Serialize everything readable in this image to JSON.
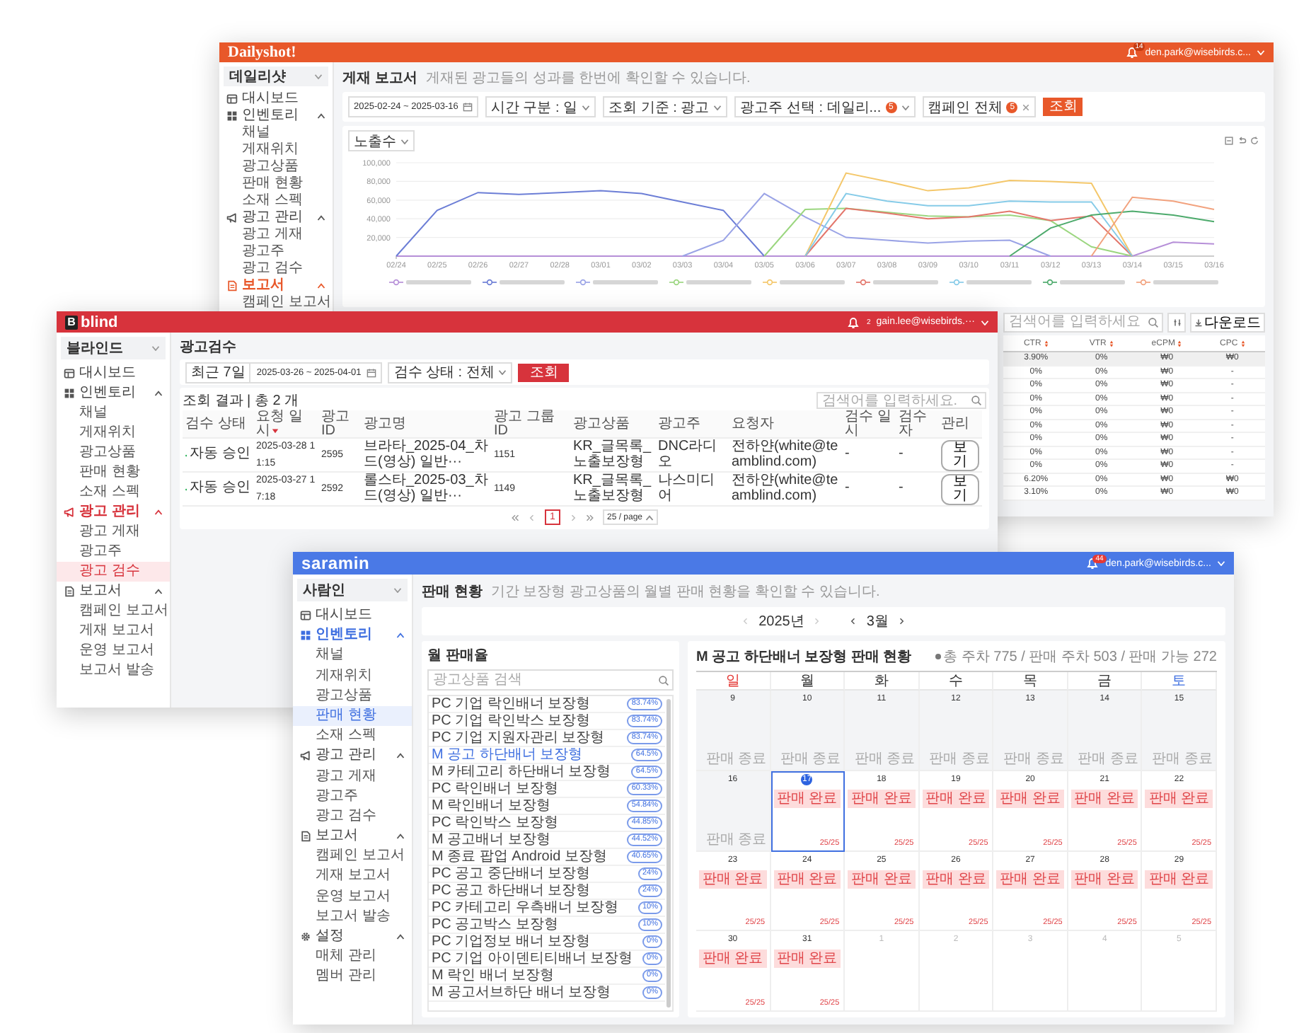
{
  "dailyshot": {
    "header": {
      "logo": "Dailyshot!",
      "notification_count": "14",
      "user": "den.park@wisebirds.c..."
    },
    "sidebar": {
      "workspace": "데일리샷",
      "items": [
        {
          "label": "대시보드",
          "kind": "dashboard",
          "active": false
        },
        {
          "label": "인벤토리",
          "kind": "inventory",
          "active": false,
          "expanded": true,
          "children": [
            {
              "label": "채널",
              "selected": false
            },
            {
              "label": "게재위치",
              "selected": false
            },
            {
              "label": "광고상품",
              "selected": false
            },
            {
              "label": "판매 현황",
              "selected": false
            },
            {
              "label": "소재 스펙",
              "selected": false
            }
          ]
        },
        {
          "label": "광고 관리",
          "kind": "ads",
          "active": false,
          "expanded": true,
          "children": [
            {
              "label": "광고 게재",
              "selected": false
            },
            {
              "label": "광고주",
              "selected": false
            },
            {
              "label": "광고 검수",
              "selected": false
            }
          ]
        },
        {
          "label": "보고서",
          "kind": "report",
          "active": true,
          "expanded": true,
          "children": [
            {
              "label": "캠페인 보고서",
              "selected": false
            }
          ]
        }
      ]
    },
    "page": {
      "title": "게재 보고서",
      "subtitle": "게재된 광고들의 성과를 한번에 확인할 수 있습니다."
    },
    "filters": [
      {
        "kind": "date",
        "value": "2025-02-24 ~ 2025-03-16"
      },
      {
        "kind": "select",
        "value": "시간 구분 : 일"
      },
      {
        "kind": "select",
        "value": "조회 기준 : 광고"
      },
      {
        "kind": "select",
        "value": "광고주 선택 : 데일리...",
        "count": "5"
      },
      {
        "kind": "tag",
        "value": "캠페인 전체",
        "count": "5"
      }
    ],
    "search_button": "조회",
    "metric_select": "노출수",
    "chart_data": {
      "type": "line",
      "categories": [
        "02/24",
        "02/25",
        "02/26",
        "02/27",
        "02/28",
        "03/01",
        "03/02",
        "03/03",
        "03/04",
        "03/05",
        "03/06",
        "03/07",
        "03/08",
        "03/09",
        "03/10",
        "03/11",
        "03/12",
        "03/13",
        "03/14",
        "03/15",
        "03/16"
      ],
      "ylim": [
        0,
        100000
      ],
      "grid": true,
      "yticks": [
        {
          "value": 20000,
          "label": "20,000"
        },
        {
          "value": 40000,
          "label": "40,000"
        },
        {
          "value": 60000,
          "label": "60,000"
        },
        {
          "value": 80000,
          "label": "80,000"
        },
        {
          "value": 100000,
          "label": "100,000"
        }
      ],
      "series": [
        {
          "color": "#b68fd8",
          "values": [
            0,
            0,
            0,
            0,
            0,
            0,
            0,
            0,
            0,
            0,
            0,
            0,
            0,
            0,
            0,
            0,
            0,
            0,
            0,
            15000,
            13000
          ]
        },
        {
          "color": "#6c7ed6",
          "values": [
            0,
            49000,
            68000,
            66000,
            68000,
            70000,
            67000,
            58000,
            49000,
            0,
            null,
            null,
            null,
            null,
            null,
            null,
            null,
            null,
            null,
            null,
            null
          ]
        },
        {
          "color": "#9aa3e6",
          "values": [
            null,
            null,
            null,
            null,
            null,
            null,
            null,
            0,
            17000,
            67000,
            42000,
            20000,
            17000,
            14000,
            16000,
            17000,
            0,
            null,
            null,
            null,
            null
          ]
        },
        {
          "color": "#9bd67f",
          "values": [
            null,
            null,
            null,
            null,
            null,
            null,
            null,
            null,
            null,
            0,
            50000,
            51000,
            47000,
            43000,
            42000,
            44000,
            38000,
            10000,
            0,
            null,
            null
          ]
        },
        {
          "color": "#f4c76a",
          "values": [
            null,
            null,
            null,
            null,
            null,
            null,
            null,
            null,
            null,
            null,
            0,
            89000,
            80000,
            70000,
            73000,
            81000,
            80000,
            78000,
            0,
            null,
            null
          ]
        },
        {
          "color": "#e3766b",
          "values": [
            null,
            null,
            null,
            null,
            null,
            null,
            null,
            null,
            null,
            null,
            0,
            51000,
            46000,
            40000,
            42000,
            48000,
            38000,
            43000,
            0,
            null,
            null
          ]
        },
        {
          "color": "#86cbe8",
          "values": [
            null,
            null,
            null,
            null,
            null,
            null,
            null,
            null,
            null,
            null,
            0,
            67000,
            59000,
            54000,
            54000,
            59000,
            58000,
            58000,
            0,
            null,
            null
          ]
        },
        {
          "color": "#4daa6c",
          "values": [
            null,
            null,
            null,
            null,
            null,
            null,
            null,
            null,
            null,
            null,
            null,
            null,
            null,
            null,
            null,
            0,
            30000,
            44000,
            48000,
            44000,
            37000
          ]
        },
        {
          "color": "#f2a27e",
          "values": [
            null,
            null,
            null,
            null,
            null,
            null,
            null,
            null,
            null,
            null,
            null,
            null,
            null,
            null,
            null,
            null,
            null,
            0,
            63000,
            59000,
            50000
          ]
        }
      ]
    },
    "table": {
      "search_placeholder": "검색어를 입력하세요",
      "download_button": "다운로드",
      "columns": [
        "CTR",
        "VTR",
        "eCPM",
        "CPC"
      ],
      "rows": [
        {
          "cells": [
            "3.90%",
            "0%",
            "₩0",
            "₩0"
          ],
          "selected": true
        },
        {
          "cells": [
            "0%",
            "0%",
            "₩0",
            "-"
          ],
          "selected": false
        },
        {
          "cells": [
            "0%",
            "0%",
            "₩0",
            "-"
          ],
          "selected": false
        },
        {
          "cells": [
            "0%",
            "0%",
            "₩0",
            "-"
          ],
          "selected": false
        },
        {
          "cells": [
            "0%",
            "0%",
            "₩0",
            "-"
          ],
          "selected": false
        },
        {
          "cells": [
            "0%",
            "0%",
            "₩0",
            "-"
          ],
          "selected": false
        },
        {
          "cells": [
            "0%",
            "0%",
            "₩0",
            "-"
          ],
          "selected": false
        },
        {
          "cells": [
            "0%",
            "0%",
            "₩0",
            "-"
          ],
          "selected": false
        },
        {
          "cells": [
            "0%",
            "0%",
            "₩0",
            "-"
          ],
          "selected": false
        },
        {
          "cells": [
            "6.20%",
            "0%",
            "₩0",
            "₩0"
          ],
          "selected": false
        },
        {
          "cells": [
            "3.10%",
            "0%",
            "₩0",
            "₩0"
          ],
          "selected": false
        }
      ]
    }
  },
  "blind": {
    "header": {
      "logo_mark": "B",
      "logo": "blind",
      "notification_count": "2",
      "user": "gain.lee@wisebirds.···"
    },
    "sidebar": {
      "workspace": "블라인드",
      "items": [
        {
          "label": "대시보드",
          "kind": "dashboard",
          "active": false
        },
        {
          "label": "인벤토리",
          "kind": "inventory",
          "active": false,
          "expanded": true,
          "children": [
            {
              "label": "채널",
              "selected": false
            },
            {
              "label": "게재위치",
              "selected": false
            },
            {
              "label": "광고상품",
              "selected": false
            },
            {
              "label": "판매 현황",
              "selected": false
            },
            {
              "label": "소재 스펙",
              "selected": false
            }
          ]
        },
        {
          "label": "광고 관리",
          "kind": "ads",
          "active": true,
          "expanded": true,
          "children": [
            {
              "label": "광고 게재",
              "selected": false
            },
            {
              "label": "광고주",
              "selected": false
            },
            {
              "label": "광고 검수",
              "selected": true
            }
          ]
        },
        {
          "label": "보고서",
          "kind": "report",
          "active": false,
          "expanded": true,
          "children": [
            {
              "label": "캠페인 보고서",
              "selected": false
            },
            {
              "label": "게재 보고서",
              "selected": false
            },
            {
              "label": "운영 보고서",
              "selected": false
            },
            {
              "label": "보고서 발송",
              "selected": false
            }
          ]
        }
      ]
    },
    "page": {
      "title": "광고검수"
    },
    "filters": {
      "period": "최근 7일",
      "date_range": "2025-03-26 ~ 2025-04-01",
      "status_select": "검수 상태 : 전체",
      "search_button": "조회"
    },
    "result_summary": "조회 결과 | 총 2 개",
    "search_placeholder": "검색어를 입력하세요.",
    "table": {
      "columns": [
        {
          "label": "검수 상태",
          "sorted": false
        },
        {
          "label": "요청 일시",
          "sorted": true
        },
        {
          "label": "광고 ID",
          "sorted": false
        },
        {
          "label": "광고명",
          "sorted": false
        },
        {
          "label": "광고 그룹 ID",
          "sorted": false
        },
        {
          "label": "광고상품",
          "sorted": false
        },
        {
          "label": "광고주",
          "sorted": false
        },
        {
          "label": "요청자",
          "sorted": false
        },
        {
          "label": "검수 일시",
          "sorted": false
        },
        {
          "label": "검수자",
          "sorted": false
        },
        {
          "label": "관리",
          "sorted": false
        }
      ],
      "rows": [
        {
          "cells": [
            "자동 승인",
            "2025-03-28 11:15",
            "2595",
            "브라타_2025-04_차드(영상) 일반···",
            "1151",
            "KR_글목록_노출보장형",
            "DNC라디오",
            "전하얀(white@teamblind.com)",
            "-",
            "-",
            "보기"
          ]
        },
        {
          "cells": [
            "자동 승인",
            "2025-03-27 17:18",
            "2592",
            "롤스타_2025-03_차드(영상) 일반···",
            "1149",
            "KR_글목록_노출보장형",
            "나스미디어",
            "전하얀(white@teamblind.com)",
            "-",
            "-",
            "보기"
          ]
        }
      ]
    },
    "pagination": {
      "pages": [
        {
          "label": "1",
          "selected": true
        }
      ],
      "page_size": "25 / page"
    }
  },
  "saramin": {
    "header": {
      "logo": "saramin",
      "notification_count": "44",
      "user": "den.park@wisebirds.c..."
    },
    "sidebar": {
      "workspace": "사람인",
      "items": [
        {
          "label": "대시보드",
          "kind": "dashboard",
          "active": false
        },
        {
          "label": "인벤토리",
          "kind": "inventory",
          "active": true,
          "expanded": true,
          "children": [
            {
              "label": "채널",
              "selected": false
            },
            {
              "label": "게재위치",
              "selected": false
            },
            {
              "label": "광고상품",
              "selected": false
            },
            {
              "label": "판매 현황",
              "selected": true
            },
            {
              "label": "소재 스펙",
              "selected": false
            }
          ]
        },
        {
          "label": "광고 관리",
          "kind": "ads",
          "active": false,
          "expanded": true,
          "children": [
            {
              "label": "광고 게재",
              "selected": false
            },
            {
              "label": "광고주",
              "selected": false
            },
            {
              "label": "광고 검수",
              "selected": false
            }
          ]
        },
        {
          "label": "보고서",
          "kind": "report",
          "active": false,
          "expanded": true,
          "children": [
            {
              "label": "캠페인 보고서",
              "selected": false
            },
            {
              "label": "게재 보고서",
              "selected": false
            },
            {
              "label": "운영 보고서",
              "selected": false
            },
            {
              "label": "보고서 발송",
              "selected": false
            }
          ]
        },
        {
          "label": "설정",
          "kind": "settings",
          "active": false,
          "expanded": true,
          "children": [
            {
              "label": "매체 관리",
              "selected": false
            },
            {
              "label": "멤버 관리",
              "selected": false
            }
          ]
        }
      ]
    },
    "page": {
      "title": "판매 현황",
      "subtitle": "기간 보장형 광고상품의 월별 판매 현황을 확인할 수 있습니다."
    },
    "period": {
      "year": "2025년",
      "month": "3월"
    },
    "products": {
      "title": "월 판매율",
      "search_placeholder": "광고상품 검색",
      "items": [
        {
          "name": "PC 기업 락인배너 보장형",
          "rate": "83.74%",
          "selected": false
        },
        {
          "name": "PC 기업 락인박스 보장형",
          "rate": "83.74%",
          "selected": false
        },
        {
          "name": "PC 기업 지원자관리 보장형",
          "rate": "83.74%",
          "selected": false
        },
        {
          "name": "M 공고 하단배너 보장형",
          "rate": "64.5%",
          "selected": true
        },
        {
          "name": "M 카테고리 하단배너 보장형",
          "rate": "64.5%",
          "selected": false
        },
        {
          "name": "PC 락인배너 보장형",
          "rate": "60.33%",
          "selected": false
        },
        {
          "name": "M 락인배너 보장형",
          "rate": "54.84%",
          "selected": false
        },
        {
          "name": "PC 락인박스 보장형",
          "rate": "44.85%",
          "selected": false
        },
        {
          "name": "M 공고배너 보장형",
          "rate": "44.52%",
          "selected": false
        },
        {
          "name": "M 종료 팝업 Android 보장형",
          "rate": "40.65%",
          "selected": false
        },
        {
          "name": "PC 공고 중단배너 보장형",
          "rate": "24%",
          "selected": false
        },
        {
          "name": "PC 공고 하단배너 보장형",
          "rate": "24%",
          "selected": false
        },
        {
          "name": "PC 카테고리 우측배너 보장형",
          "rate": "10%",
          "selected": false
        },
        {
          "name": "PC 공고박스 보장형",
          "rate": "10%",
          "selected": false
        },
        {
          "name": "PC 기업정보 배너 보장형",
          "rate": "0%",
          "selected": false
        },
        {
          "name": "PC 기업 아이덴티티배너 보장형",
          "rate": "0%",
          "selected": false
        },
        {
          "name": "M 락인 배너 보장형",
          "rate": "0%",
          "selected": false
        },
        {
          "name": "M 공고서브하단 배너 보장형",
          "rate": "0%",
          "selected": false
        }
      ]
    },
    "calendar": {
      "title": "M 공고 하단배너 보장형 판매 현황",
      "summary": "총 주차 775 / 판매 주차 503 / 판매 가능 272",
      "weekdays": [
        {
          "label": "일",
          "kind": "sunday"
        },
        {
          "label": "월",
          "kind": "weekday"
        },
        {
          "label": "화",
          "kind": "weekday"
        },
        {
          "label": "수",
          "kind": "weekday"
        },
        {
          "label": "목",
          "kind": "weekday"
        },
        {
          "label": "금",
          "kind": "weekday"
        },
        {
          "label": "토",
          "kind": "saturday"
        }
      ],
      "days": [
        {
          "date": "9",
          "kind": "past",
          "label": "판매 종료",
          "today": false,
          "selected": false
        },
        {
          "date": "10",
          "kind": "past",
          "label": "판매 종료",
          "today": false,
          "selected": false
        },
        {
          "date": "11",
          "kind": "past",
          "label": "판매 종료",
          "today": false,
          "selected": false
        },
        {
          "date": "12",
          "kind": "past",
          "label": "판매 종료",
          "today": false,
          "selected": false
        },
        {
          "date": "13",
          "kind": "past",
          "label": "판매 종료",
          "today": false,
          "selected": false
        },
        {
          "date": "14",
          "kind": "past",
          "label": "판매 종료",
          "today": false,
          "selected": false
        },
        {
          "date": "15",
          "kind": "past",
          "label": "판매 종료",
          "today": false,
          "selected": false
        },
        {
          "date": "16",
          "kind": "past",
          "label": "판매 종료",
          "today": false,
          "selected": false
        },
        {
          "date": "17",
          "kind": "sold",
          "label": "판매 완료",
          "count": "25/25",
          "today": true,
          "selected": true
        },
        {
          "date": "18",
          "kind": "sold",
          "label": "판매 완료",
          "count": "25/25",
          "today": false,
          "selected": false
        },
        {
          "date": "19",
          "kind": "sold",
          "label": "판매 완료",
          "count": "25/25",
          "today": false,
          "selected": false
        },
        {
          "date": "20",
          "kind": "sold",
          "label": "판매 완료",
          "count": "25/25",
          "today": false,
          "selected": false
        },
        {
          "date": "21",
          "kind": "sold",
          "label": "판매 완료",
          "count": "25/25",
          "today": false,
          "selected": false
        },
        {
          "date": "22",
          "kind": "sold",
          "label": "판매 완료",
          "count": "25/25",
          "today": false,
          "selected": false
        },
        {
          "date": "23",
          "kind": "sold",
          "label": "판매 완료",
          "count": "25/25",
          "today": false,
          "selected": false
        },
        {
          "date": "24",
          "kind": "sold",
          "label": "판매 완료",
          "count": "25/25",
          "today": false,
          "selected": false
        },
        {
          "date": "25",
          "kind": "sold",
          "label": "판매 완료",
          "count": "25/25",
          "today": false,
          "selected": false
        },
        {
          "date": "26",
          "kind": "sold",
          "label": "판매 완료",
          "count": "25/25",
          "today": false,
          "selected": false
        },
        {
          "date": "27",
          "kind": "sold",
          "label": "판매 완료",
          "count": "25/25",
          "today": false,
          "selected": false
        },
        {
          "date": "28",
          "kind": "sold",
          "label": "판매 완료",
          "count": "25/25",
          "today": false,
          "selected": false
        },
        {
          "date": "29",
          "kind": "sold",
          "label": "판매 완료",
          "count": "25/25",
          "today": false,
          "selected": false
        },
        {
          "date": "30",
          "kind": "sold",
          "label": "판매 완료",
          "count": "25/25",
          "today": false,
          "selected": false
        },
        {
          "date": "31",
          "kind": "sold",
          "label": "판매 완료",
          "count": "25/25",
          "today": false,
          "selected": false
        },
        {
          "date": "1",
          "kind": "other",
          "today": false,
          "selected": false
        },
        {
          "date": "2",
          "kind": "other",
          "today": false,
          "selected": false
        },
        {
          "date": "3",
          "kind": "other",
          "today": false,
          "selected": false
        },
        {
          "date": "4",
          "kind": "other",
          "today": false,
          "selected": false
        },
        {
          "date": "5",
          "kind": "other",
          "today": false,
          "selected": false
        }
      ]
    }
  }
}
